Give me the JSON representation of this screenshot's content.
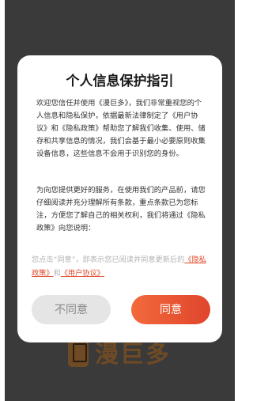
{
  "background": {
    "app_name": "漫巨多"
  },
  "dialog": {
    "title": "个人信息保护指引",
    "paragraph1": "欢迎您信任并使用《漫巨多》，我们非常重视您的个人信息和隐私保护，依据最新法律制定了《用户协议》和《隐私政策》帮助您了解我们收集、使用、储存和共享信息的情况，我们会基于最小必要原则收集设备信息，这些信息不会用于识别您的身份。",
    "paragraph2": "为向您提供更好的服务，在使用我们的产品前，请您仔细阅读并充分理解所有条款，重点条款已为您标注，方便您了解自己的相关权利，我们将通过《隐私政策》向您说明：",
    "notice_prefix": "您点击“同意”，即表示您已阅读并同意更新后的",
    "privacy_link": "《隐私政策》",
    "notice_and": "和",
    "user_agreement_link": "《用户协议》",
    "disagree_label": "不同意",
    "agree_label": "同意"
  },
  "colors": {
    "accent": "#e0492a",
    "overlay": "#3a3a3a"
  }
}
